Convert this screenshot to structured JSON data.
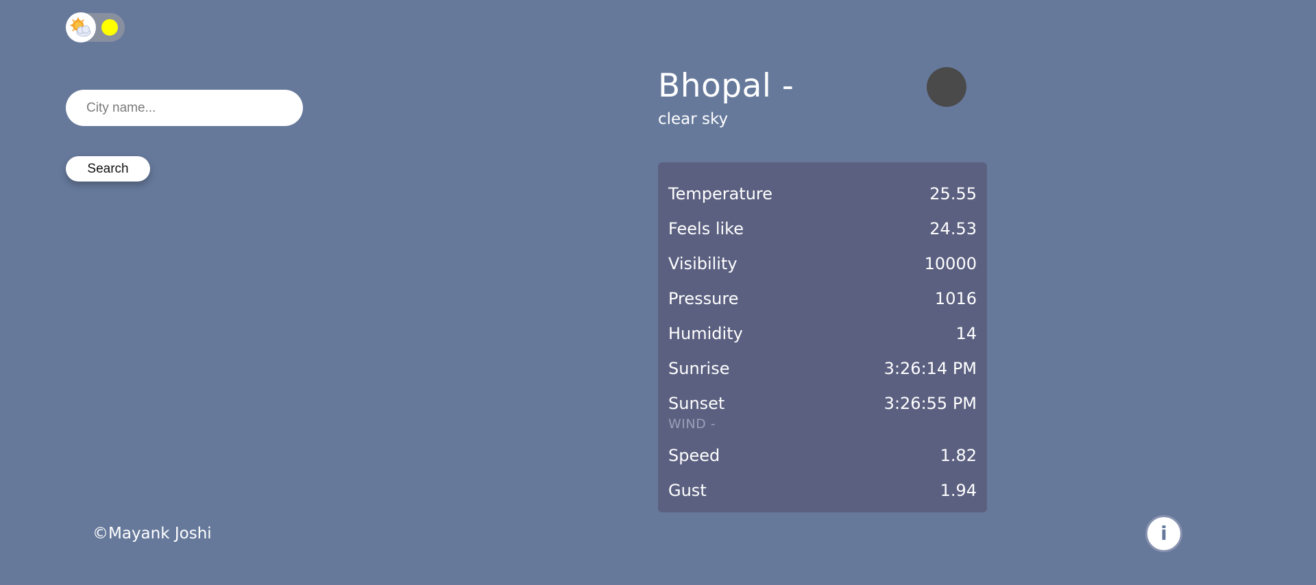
{
  "theme_toggle": {
    "knob_icon": "sun-behind-cloud-icon",
    "sun_icon": "sun-icon",
    "colors": {
      "sun": "#ffff00",
      "track": "#8890a0"
    }
  },
  "search": {
    "placeholder": "City name...",
    "value": "",
    "button_label": "Search"
  },
  "weather": {
    "city_title": "Bhopal -",
    "description": "clear sky",
    "icon": "weather-icon"
  },
  "stats": [
    {
      "label": "Temperature",
      "value": "25.55"
    },
    {
      "label": "Feels like",
      "value": "24.53"
    },
    {
      "label": "Visibility",
      "value": "10000"
    },
    {
      "label": "Pressure",
      "value": "1016"
    },
    {
      "label": "Humidity",
      "value": "14"
    },
    {
      "label": "Sunrise",
      "value": "3:26:14 PM"
    },
    {
      "label": "Sunset",
      "value": "3:26:55 PM"
    }
  ],
  "wind": {
    "heading": "WIND -",
    "stats": [
      {
        "label": "Speed",
        "value": "1.82"
      },
      {
        "label": "Gust",
        "value": "1.94"
      }
    ]
  },
  "footer": {
    "copyright": "©Mayank Joshi",
    "info_label": "i"
  },
  "colors": {
    "background": "#66799b",
    "card": "#5b6080"
  }
}
